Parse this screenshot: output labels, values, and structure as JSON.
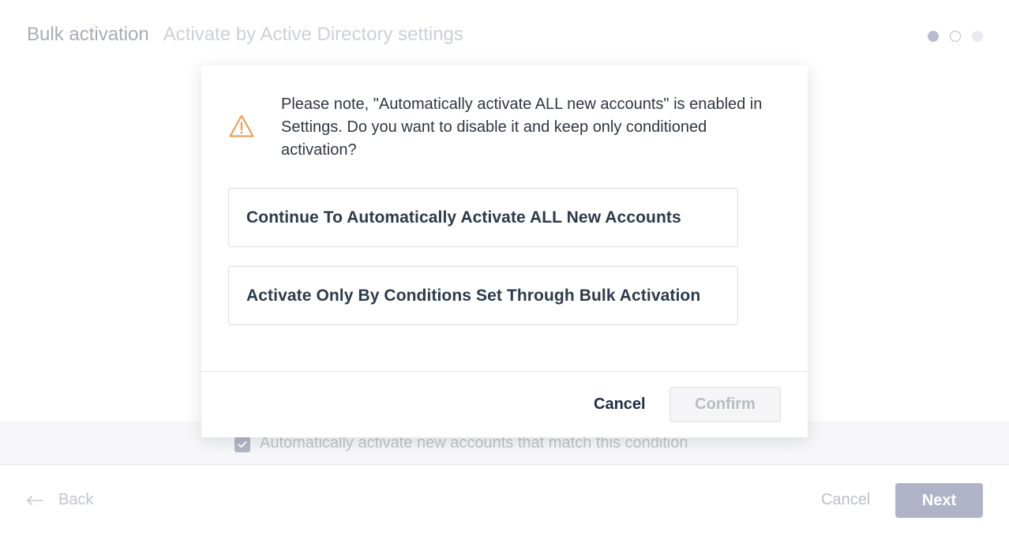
{
  "header": {
    "title": "Bulk activation",
    "subtitle": "Activate by Active Directory settings"
  },
  "stepper": {
    "current": 1,
    "total": 3
  },
  "background": {
    "checkbox_label": "Automatically activate new accounts that match this condition",
    "checkbox_checked": true
  },
  "footer": {
    "back_label": "Back",
    "cancel_label": "Cancel",
    "next_label": "Next"
  },
  "modal": {
    "icon": "warning-triangle-icon",
    "message": "Please note, \"Automatically activate ALL new accounts\" is enabled in Settings. Do you want to disable it and keep only conditioned activation?",
    "options": [
      {
        "label": "Continue To Automatically Activate ALL New Accounts"
      },
      {
        "label": "Activate Only By Conditions Set Through Bulk Activation"
      }
    ],
    "cancel_label": "Cancel",
    "confirm_label": "Confirm"
  },
  "colors": {
    "warning": "#e8a15a",
    "next_button": "#b0b3c7",
    "heading_text": "#2c3a4a"
  }
}
